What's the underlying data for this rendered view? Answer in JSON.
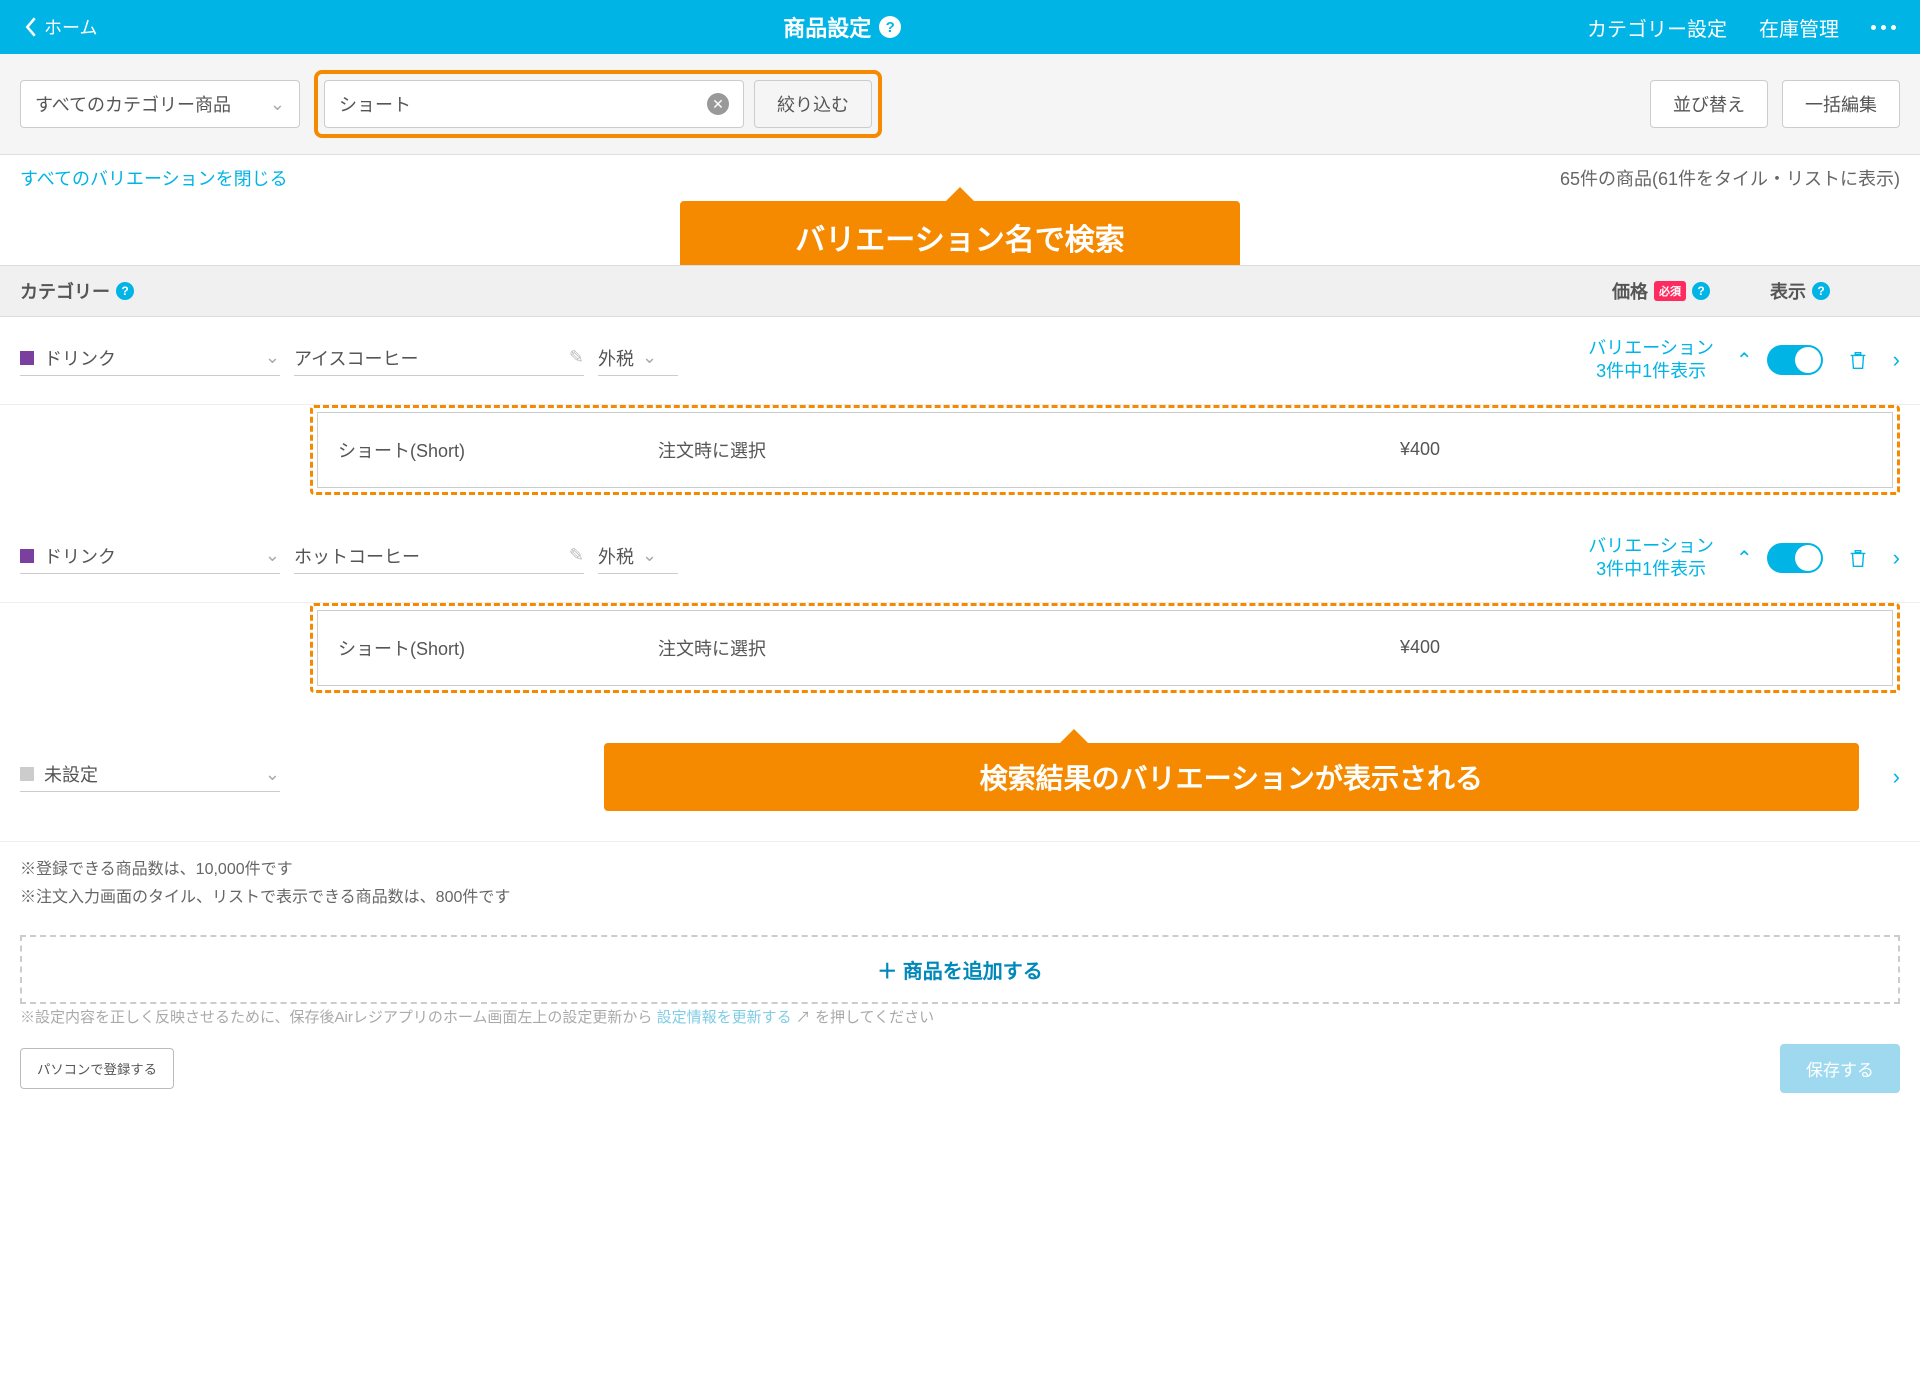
{
  "header": {
    "back": "ホーム",
    "title": "商品設定",
    "nav1": "カテゴリー設定",
    "nav2": "在庫管理"
  },
  "toolbar": {
    "category_select": "すべてのカテゴリー商品",
    "search_value": "ショート",
    "filter_btn": "絞り込む",
    "sort_btn": "並び替え",
    "bulk_btn": "一括編集"
  },
  "subbar": {
    "close_all": "すべてのバリエーションを閉じる",
    "count": "65件の商品(61件をタイル・リストに表示)"
  },
  "callout1": "バリエーション名で検索",
  "columns": {
    "category": "カテゴリー",
    "price": "価格",
    "required": "必須",
    "display": "表示"
  },
  "products": [
    {
      "category": "ドリンク",
      "name": "アイスコーヒー",
      "tax": "外税",
      "var_label": "バリエーション",
      "var_count": "3件中1件表示",
      "variation": {
        "name": "ショート(Short)",
        "select": "注文時に選択",
        "price": "¥400"
      }
    },
    {
      "category": "ドリンク",
      "name": "ホットコーヒー",
      "tax": "外税",
      "var_label": "バリエーション",
      "var_count": "3件中1件表示",
      "variation": {
        "name": "ショート(Short)",
        "select": "注文時に選択",
        "price": "¥400"
      }
    }
  ],
  "unset_row": {
    "category": "未設定"
  },
  "callout2": "検索結果のバリエーションが表示される",
  "notes": {
    "l1": "※登録できる商品数は、10,000件です",
    "l2": "※注文入力画面のタイル、リストで表示できる商品数は、800件です"
  },
  "add_btn": "＋ 商品を追加する",
  "footer": {
    "hint_pre": "※設定内容を正しく反映させるために、保存後Airレジアプリのホーム画面左上の設定更新から",
    "hint_link": "設定情報を更新する",
    "hint_post": "を押してください",
    "pc_btn": "パソコンで登録する",
    "save_btn": "保存する"
  }
}
